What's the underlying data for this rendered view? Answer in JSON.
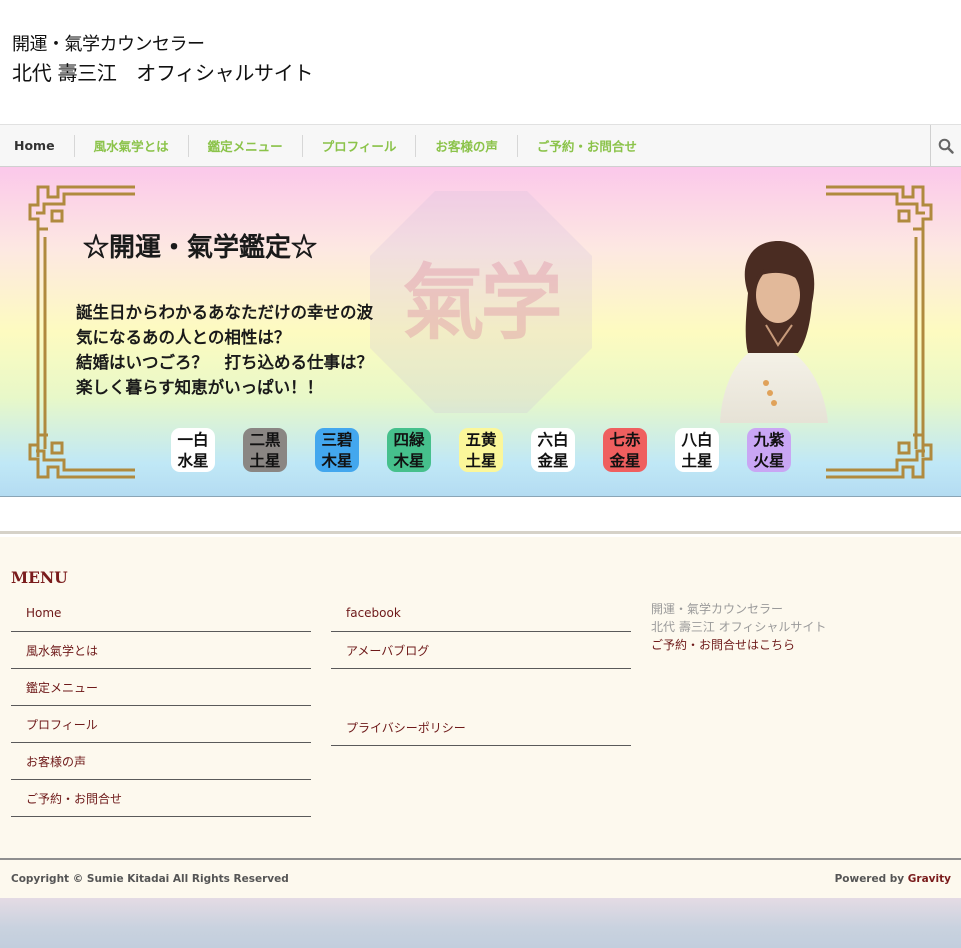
{
  "header": {
    "title_line1": "開運・氣学カウンセラー",
    "title_line2": "北代 壽三江　オフィシャルサイト"
  },
  "nav": {
    "items": [
      {
        "label": "Home"
      },
      {
        "label": "風水氣学とは"
      },
      {
        "label": "鑑定メニュー"
      },
      {
        "label": "プロフィール"
      },
      {
        "label": "お客様の声"
      },
      {
        "label": "ご予約・お問合せ"
      }
    ],
    "search_icon": "search-icon"
  },
  "hero": {
    "heading": "☆開運・氣学鑑定☆",
    "bg_kanji": "氣学",
    "lines": [
      "誕生日からわかるあなただけの幸せの波",
      "気になるあの人との相性は？",
      "結婚はいつごろ？　打ち込める仕事は？",
      "楽しく暮らす知恵がいっぱい！！"
    ],
    "stars": [
      {
        "top": "一白",
        "bottom": "水星",
        "bg": "#ffffff",
        "color": "#111111"
      },
      {
        "top": "二黒",
        "bottom": "土星",
        "bg": "#8a8683",
        "color": "#111111"
      },
      {
        "top": "三碧",
        "bottom": "木星",
        "bg": "#43a7ee",
        "color": "#111111"
      },
      {
        "top": "四緑",
        "bottom": "木星",
        "bg": "#46c08c",
        "color": "#111111"
      },
      {
        "top": "五黄",
        "bottom": "土星",
        "bg": "#fbf79a",
        "color": "#111111"
      },
      {
        "top": "六白",
        "bottom": "金星",
        "bg": "#ffffff",
        "color": "#111111"
      },
      {
        "top": "七赤",
        "bottom": "金星",
        "bg": "#ef5f5f",
        "color": "#111111"
      },
      {
        "top": "八白",
        "bottom": "土星",
        "bg": "#ffffff",
        "color": "#111111"
      },
      {
        "top": "九紫",
        "bottom": "火星",
        "bg": "#c9a6f4",
        "color": "#111111"
      }
    ]
  },
  "footer": {
    "menu_title": "MENU",
    "col1": [
      {
        "label": "Home"
      },
      {
        "label": "風水氣学とは"
      },
      {
        "label": "鑑定メニュー"
      },
      {
        "label": "プロフィール"
      },
      {
        "label": "お客様の声"
      },
      {
        "label": "ご予約・お問合せ"
      }
    ],
    "col2": [
      {
        "label": "facebook"
      },
      {
        "label": "アメーバブログ"
      },
      {
        "label": "プライバシーポリシー"
      }
    ],
    "col3": {
      "line1": "開運・氣学カウンセラー",
      "line2": "北代 壽三江 オフィシャルサイト",
      "link": "ご予約・お問合せはこちら"
    }
  },
  "bottom": {
    "copyright": "Copyright © Sumie Kitadai All Rights Reserved",
    "powered_prefix": "Powered by ",
    "powered_brand": "Gravity"
  },
  "colors": {
    "nav_accent": "#8bc34a",
    "footer_link": "#6e1919",
    "frame_gold": "#b08a3e"
  }
}
